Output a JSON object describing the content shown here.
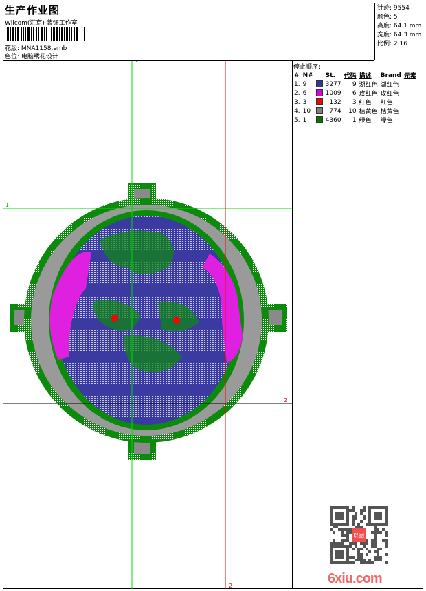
{
  "header": {
    "title": "生产作业图",
    "company": "Wilcom(汇京) 装饰工作室",
    "design_label": "花版:",
    "design_file": "MNA1158.emb",
    "colorway_label": "色位:",
    "colorway": "电脑绣花设计"
  },
  "stats": {
    "stitches": "针迹: 9554",
    "colors": "颜色: 5",
    "height": "高度: 64.1 mm",
    "width": "宽度: 64.3 mm",
    "scale": "比例: 2.16"
  },
  "stop_sequence": {
    "title": "停止顺序:",
    "columns": [
      "#",
      "N#",
      "St.",
      "代码",
      "描述",
      "Brand",
      "元素"
    ],
    "rows": [
      {
        "idx": "1.",
        "n": "9",
        "color": "#33339a",
        "st": "3277",
        "code": "9",
        "desc": "湖红色",
        "brand": "湖红色"
      },
      {
        "idx": "2.",
        "n": "6",
        "color": "#dd00dd",
        "st": "1009",
        "code": "6",
        "desc": "玫红色",
        "brand": "玫红色"
      },
      {
        "idx": "3.",
        "n": "3",
        "color": "#ff0000",
        "st": "132",
        "code": "3",
        "desc": "红色",
        "brand": "红色"
      },
      {
        "idx": "4.",
        "n": "10",
        "color": "#808080",
        "st": "774",
        "code": "10",
        "desc": "桔黄色",
        "brand": "桔黄色"
      },
      {
        "idx": "5.",
        "n": "1",
        "color": "#007700",
        "st": "4360",
        "code": "1",
        "desc": "绿色",
        "brand": "绿色"
      }
    ]
  },
  "guides": {
    "v1": "1",
    "h1": "1",
    "h2": "2",
    "v2": "2"
  },
  "watermark": {
    "site": "6xiu.com",
    "seal": "以图看版"
  }
}
